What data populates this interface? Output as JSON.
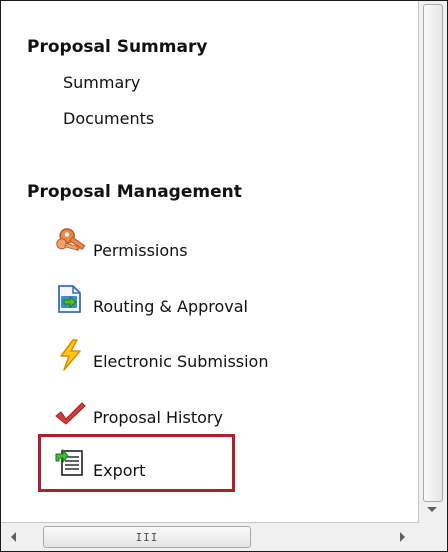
{
  "sections": {
    "summary": {
      "heading": "Proposal Summary",
      "links": [
        "Summary",
        "Documents"
      ]
    },
    "management": {
      "heading": "Proposal Management",
      "items": [
        {
          "label": "Permissions",
          "icon": "keys-icon"
        },
        {
          "label": "Routing & Approval",
          "icon": "routing-arrow-icon"
        },
        {
          "label": "Electronic Submission",
          "icon": "lightning-bolt-icon"
        },
        {
          "label": "Proposal History",
          "icon": "checkmark-icon"
        },
        {
          "label": "Export",
          "icon": "export-icon"
        }
      ]
    }
  },
  "scrollbar": {
    "horizontal_grip": "III"
  },
  "colors": {
    "highlight_border": "#b0202a",
    "text": "#111111"
  }
}
